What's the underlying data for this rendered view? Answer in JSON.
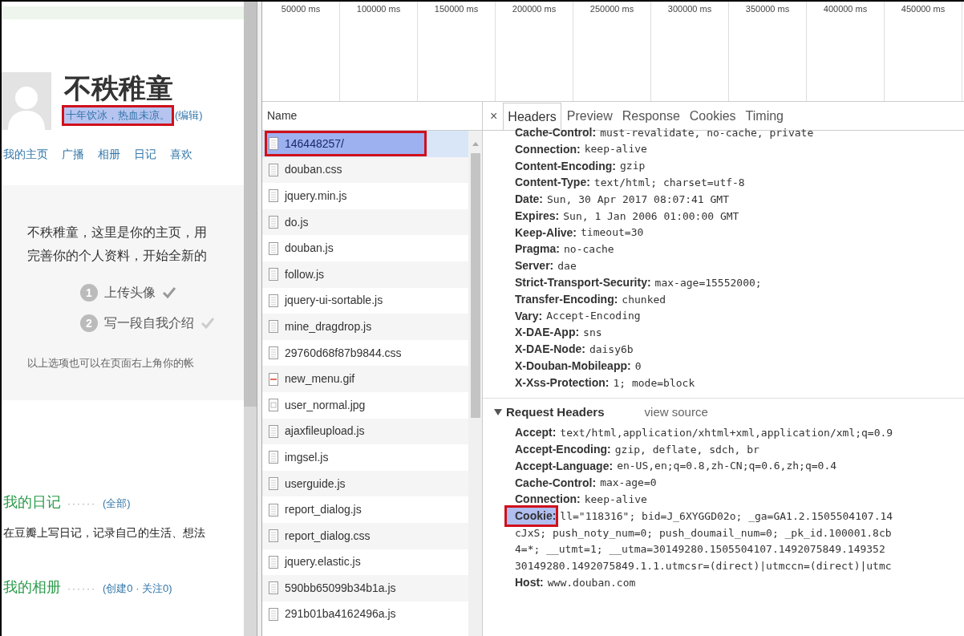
{
  "page": {
    "name": "不秩稚童",
    "bio": {
      "text": "十年饮冰，热血未凉。",
      "selected": true,
      "annotated": true
    },
    "edit_link": "(编辑)",
    "nav": [
      "我的主页",
      "广播",
      "相册",
      "日记",
      "喜欢"
    ],
    "intro": "不秩稚童，这里是你的主页，用完善你的个人资料，开始全新的",
    "steps": [
      {
        "number": "1",
        "label": "上传头像",
        "done": true
      },
      {
        "number": "2",
        "label": "写一段自我介绍",
        "done": false
      }
    ],
    "note": "以上选项也可以在页面右上角你的帐",
    "sections": [
      {
        "title": "我的日记",
        "dots": "······",
        "link": "(全部)",
        "text": "在豆瓣上写日记，记录自己的生活、想法"
      },
      {
        "title": "我的相册",
        "dots": "······",
        "link": "(创建0 · 关注0)"
      }
    ]
  },
  "timeline": {
    "ticks": [
      "50000 ms",
      "100000 ms",
      "150000 ms",
      "200000 ms",
      "250000 ms",
      "300000 ms",
      "350000 ms",
      "400000 ms",
      "450000 ms"
    ]
  },
  "requests": {
    "column": "Name",
    "rows": [
      {
        "name": "146448257/",
        "kind": "document",
        "selected": true,
        "annotated": true
      },
      {
        "name": "douban.css",
        "kind": "document",
        "selected": false,
        "annotated": false
      },
      {
        "name": "jquery.min.js",
        "kind": "document",
        "selected": false,
        "annotated": false
      },
      {
        "name": "do.js",
        "kind": "document",
        "selected": false,
        "annotated": false
      },
      {
        "name": "douban.js",
        "kind": "document",
        "selected": false,
        "annotated": false
      },
      {
        "name": "follow.js",
        "kind": "document",
        "selected": false,
        "annotated": false
      },
      {
        "name": "jquery-ui-sortable.js",
        "kind": "document",
        "selected": false,
        "annotated": false
      },
      {
        "name": "mine_dragdrop.js",
        "kind": "document",
        "selected": false,
        "annotated": false
      },
      {
        "name": "29760d68f87b9844.css",
        "kind": "document",
        "selected": false,
        "annotated": false
      },
      {
        "name": "new_menu.gif",
        "kind": "gif",
        "selected": false,
        "annotated": false
      },
      {
        "name": "user_normal.jpg",
        "kind": "image",
        "selected": false,
        "annotated": false
      },
      {
        "name": "ajaxfileupload.js",
        "kind": "document",
        "selected": false,
        "annotated": false
      },
      {
        "name": "imgsel.js",
        "kind": "document",
        "selected": false,
        "annotated": false
      },
      {
        "name": "userguide.js",
        "kind": "document",
        "selected": false,
        "annotated": false
      },
      {
        "name": "report_dialog.js",
        "kind": "document",
        "selected": false,
        "annotated": false
      },
      {
        "name": "report_dialog.css",
        "kind": "document",
        "selected": false,
        "annotated": false
      },
      {
        "name": "jquery.elastic.js",
        "kind": "document",
        "selected": false,
        "annotated": false
      },
      {
        "name": "590bb65099b34b1a.js",
        "kind": "document",
        "selected": false,
        "annotated": false
      },
      {
        "name": "291b01ba4162496a.js",
        "kind": "document",
        "selected": false,
        "annotated": false
      }
    ]
  },
  "details": {
    "close": "×",
    "tabs": [
      {
        "label": "Headers",
        "selected": true
      },
      {
        "label": "Preview",
        "selected": false
      },
      {
        "label": "Response",
        "selected": false
      },
      {
        "label": "Cookies",
        "selected": false
      },
      {
        "label": "Timing",
        "selected": false
      }
    ],
    "response_headers": [
      {
        "key": "Cache-Control:",
        "value": "must-revalidate, no-cache, private"
      },
      {
        "key": "Connection:",
        "value": "keep-alive"
      },
      {
        "key": "Content-Encoding:",
        "value": "gzip"
      },
      {
        "key": "Content-Type:",
        "value": "text/html; charset=utf-8"
      },
      {
        "key": "Date:",
        "value": "Sun, 30 Apr 2017 08:07:41 GMT"
      },
      {
        "key": "Expires:",
        "value": "Sun, 1 Jan 2006 01:00:00 GMT"
      },
      {
        "key": "Keep-Alive:",
        "value": "timeout=30"
      },
      {
        "key": "Pragma:",
        "value": "no-cache"
      },
      {
        "key": "Server:",
        "value": "dae"
      },
      {
        "key": "Strict-Transport-Security:",
        "value": "max-age=15552000;"
      },
      {
        "key": "Transfer-Encoding:",
        "value": "chunked"
      },
      {
        "key": "Vary:",
        "value": "Accept-Encoding"
      },
      {
        "key": "X-DAE-App:",
        "value": "sns"
      },
      {
        "key": "X-DAE-Node:",
        "value": "daisy6b"
      },
      {
        "key": "X-Douban-Mobileapp:",
        "value": "0"
      },
      {
        "key": "X-Xss-Protection:",
        "value": "1; mode=block"
      }
    ],
    "request_section": {
      "title": "Request Headers",
      "expanded": true,
      "link": "view source"
    },
    "request_headers": [
      {
        "key": "Accept:",
        "value": "text/html,application/xhtml+xml,application/xml;q=0.9",
        "selected": false,
        "annotated": false
      },
      {
        "key": "Accept-Encoding:",
        "value": "gzip, deflate, sdch, br",
        "selected": false,
        "annotated": false
      },
      {
        "key": "Accept-Language:",
        "value": "en-US,en;q=0.8,zh-CN;q=0.6,zh;q=0.4",
        "selected": false,
        "annotated": false
      },
      {
        "key": "Cache-Control:",
        "value": "max-age=0",
        "selected": false,
        "annotated": false
      },
      {
        "key": "Connection:",
        "value": "keep-alive",
        "selected": false,
        "annotated": false
      },
      {
        "key": "Cookie:",
        "value": "ll=\"118316\"; bid=J_6XYGGD02o; _ga=GA1.2.1505504107.14",
        "more": [
          "cJxS; push_noty_num=0; push_doumail_num=0; _pk_id.100001.8cb",
          "4=*; __utmt=1; __utma=30149280.1505504107.1492075849.149352",
          "30149280.1492075849.1.1.utmcsr=(direct)|utmccn=(direct)|utmc"
        ],
        "selected": true,
        "annotated": true
      },
      {
        "key": "Host:",
        "value": "www.douban.com",
        "selected": false,
        "annotated": false
      }
    ]
  }
}
